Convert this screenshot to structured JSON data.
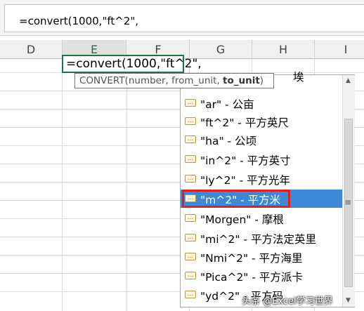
{
  "formula_bar": {
    "value": "=convert(1000,\"ft^2\","
  },
  "columns": [
    "D",
    "E",
    "F",
    "G",
    "H",
    "I"
  ],
  "active_column": "E",
  "active_cell": {
    "text": "=convert(1000,\"ft^2\","
  },
  "tooltip": {
    "func": "CONVERT(number, from_unit, ",
    "current_arg": "to_unit",
    "end": ")"
  },
  "dropdown": {
    "items": [
      {
        "label": "\"Morgen\" - 摩根"
      },
      {
        "label": "\"ar\" - 公亩"
      },
      {
        "label": "\"ft^2\" - 平方英尺"
      },
      {
        "label": "\"ha\" - 公顷"
      },
      {
        "label": "\"in^2\" - 平方英寸"
      },
      {
        "label": "\"ly^2\" - 平方光年"
      },
      {
        "label": "\"m^2\" - 平方米"
      },
      {
        "label": "\"Morgen\" - 摩根"
      },
      {
        "label": "\"mi^2\" - 平方法定英里"
      },
      {
        "label": "\"Nmi^2\" - 平方海里"
      },
      {
        "label": "\"Pica^2\" - 平方派卡"
      },
      {
        "label": "\"yd^2\" - 平方码"
      }
    ],
    "partial_top_item": "埃",
    "selected_index": 6,
    "selected_color": "#3d89d6",
    "highlight_color": "#e02020"
  },
  "watermark": "头条 @Excel学习世界"
}
